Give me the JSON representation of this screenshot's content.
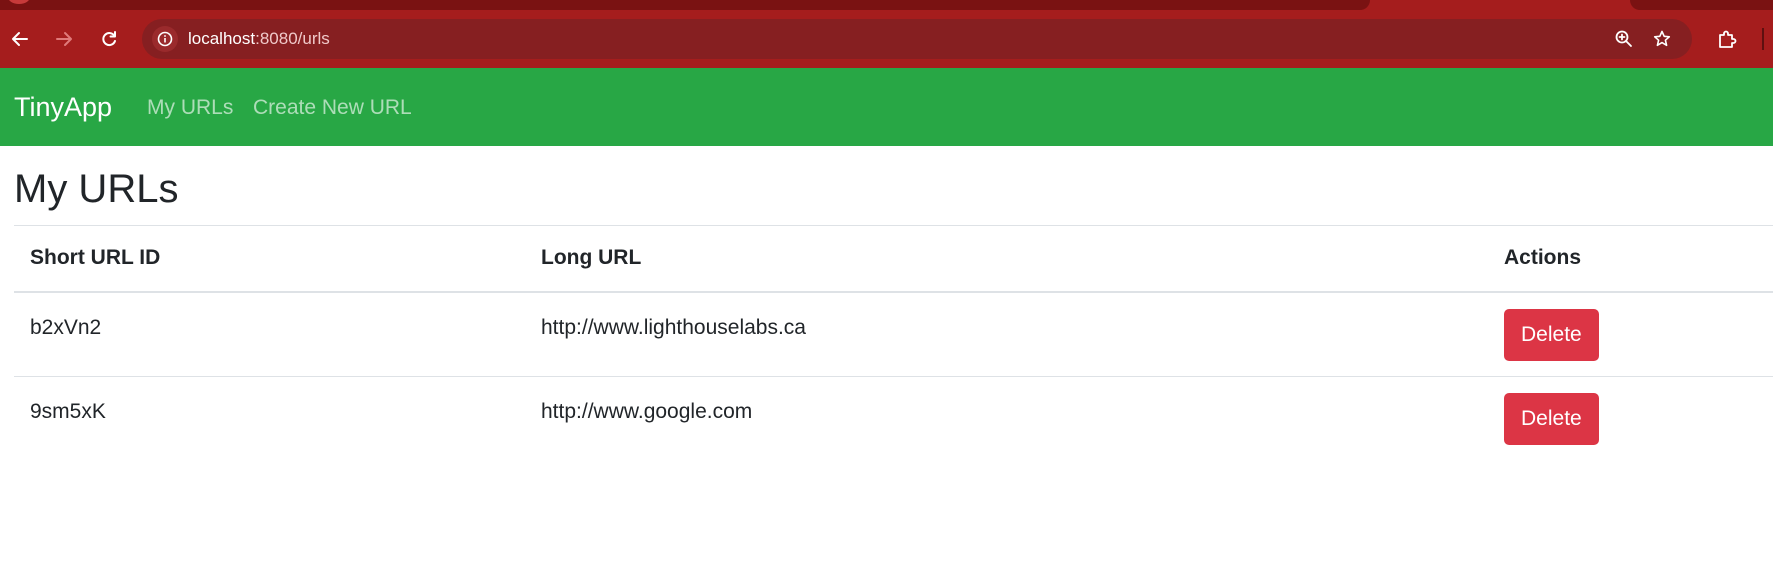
{
  "browser": {
    "url_host": "localhost",
    "url_path": ":8080/urls",
    "icons": {
      "back": "arrow-left-icon",
      "forward": "arrow-right-icon",
      "reload": "reload-icon",
      "site_info": "info-icon",
      "zoom": "zoom-in-icon",
      "bookmark": "star-icon",
      "extensions": "puzzle-icon"
    }
  },
  "navbar": {
    "brand": "TinyApp",
    "links": [
      {
        "label": "My URLs"
      },
      {
        "label": "Create New URL"
      }
    ]
  },
  "main": {
    "title": "My URLs",
    "table": {
      "headers": [
        "Short URL ID",
        "Long URL",
        "Actions"
      ],
      "rows": [
        {
          "short_id": "b2xVn2",
          "long_url": "http://www.lighthouselabs.ca",
          "action": "Delete"
        },
        {
          "short_id": "9sm5xK",
          "long_url": "http://www.google.com",
          "action": "Delete"
        }
      ]
    }
  },
  "colors": {
    "browser_frame": "#a51d1d",
    "omnibox": "#861f21",
    "navbar": "#28a745",
    "danger": "#dc3545",
    "text": "#212529"
  }
}
